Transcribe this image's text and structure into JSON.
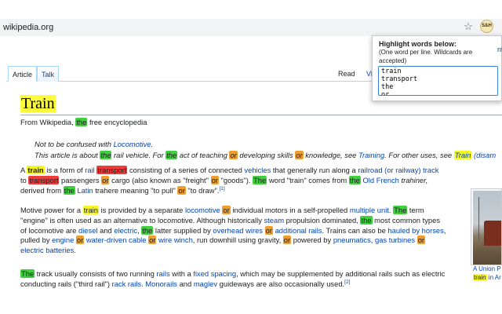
{
  "browser": {
    "url": "wikipedia.org",
    "star_icon": "star-icon",
    "extension_badge": "S&H"
  },
  "tabs": {
    "article": "Article",
    "talk": "Talk",
    "read": "Read",
    "view": "Vi"
  },
  "popup": {
    "title": "Highlight words below:",
    "hint_1": "(One word per line. Wildcards are",
    "hint_2": "accepted)",
    "words": [
      "train",
      "transport",
      "the",
      "or"
    ],
    "right_fragment": "nt"
  },
  "colors": {
    "train": "#f7f71e",
    "transport": "#ee3b3b",
    "the": "#3fcf3f",
    "or": "#f19d2c",
    "link": "#0645ad"
  },
  "article": {
    "title": "Train",
    "from": {
      "pre": "From Wikipedia, ",
      "the": "the",
      "post": " free encyclopedia"
    },
    "hatnote1": {
      "a": "Not to be confused with ",
      "link": "Locomotive",
      "b": "."
    },
    "hatnote2": {
      "a": "This article is about ",
      "the": "the",
      "b": " rail vehicle. For ",
      "the2": "the",
      "c": " act of teaching ",
      "or1": "or",
      "d": " developing skills ",
      "or2": "or",
      "e": " knowledge, see ",
      "link1": "Training",
      "f": ". For other uses, see ",
      "link2": "Train",
      "g": " (disam"
    },
    "p1": {
      "l1": {
        "a": "A ",
        "train": "train",
        "b": " is a form of ",
        "rail": "rail",
        "c": " ",
        "transport": "transport",
        "d": " consisting of a series of connected ",
        "vehicles": "vehicles",
        "e": " that generally run along a ",
        "railroad": "railroad (or railway) track"
      },
      "l2": {
        "a": "to ",
        "transport": "transport",
        "b": " passengers ",
        "or1": "or",
        "c": " cargo (also known as \"freight\" ",
        "or2": "or",
        "d": " \"goods\"). ",
        "the": "The",
        "e": " word \"train\" comes from ",
        "the2": "the",
        "f": " ",
        "oldfrench": "Old French",
        "g": " trahiner,"
      },
      "l3": {
        "a": "derived from ",
        "the": "the",
        "b": " ",
        "latin": "Latin",
        "c": " trahere meaning \"to pull\" ",
        "or": "or",
        "d": " \"to draw\".",
        "sup": "[1]"
      }
    },
    "p2": {
      "l1": {
        "a": "Motive power for a ",
        "train": "train",
        "b": " is provided by a separate ",
        "loco": "locomotive",
        "c": " ",
        "or": "or",
        "d": " individual motors in a self-propelled ",
        "mu": "multiple unit",
        "e": ". ",
        "the": "The",
        "f": " term"
      },
      "l2": {
        "a": "\"engine\" is often used as an alternative to locomotive. Although historically ",
        "steam": "steam",
        "b": " propulsion dominated, ",
        "the": "the",
        "c": " most common types"
      },
      "l3": {
        "a": "of locomotive are ",
        "diesel": "diesel",
        "b": " and ",
        "electric": "electric",
        "c": ", ",
        "the": "the",
        "d": " latter supplied by ",
        "ohw": "overhead wires",
        "e": " ",
        "or": "or",
        "f": " ",
        "add": "additional rails",
        "g": ". Trains can also be ",
        "horses": "hauled by horses",
        "h": ","
      },
      "l4": {
        "a": "pulled by ",
        "engine": "engine",
        "b": " ",
        "or1": "or",
        "c": " ",
        "wdc": "water-driven cable",
        "d": " ",
        "or2": "or",
        "e": " ",
        "winch": "wire winch",
        "f": ", run downhill using gravity, ",
        "or3": "or",
        "g": " powered by ",
        "pneu": "pneumatics",
        "h": ", ",
        "gas": "gas turbines",
        "i": " ",
        "or4": "or"
      },
      "l5": {
        "batt": "electric batteries",
        "a": "."
      }
    },
    "p3": {
      "l1": {
        "the": "The",
        "a": " track usually consists of two running ",
        "rails": "rails",
        "b": " with a ",
        "fixed": "fixed spacing",
        "c": ", which may be supplemented by additional rails such as electric"
      },
      "l2": {
        "a": "conducting rails (\"third rail\") ",
        "and": "and",
        "b": " ",
        "rack": "rack rails",
        "c": ". ",
        "mono": "Monorails",
        "d": " and ",
        "maglev": "maglev",
        "e": " guideways are also occasionally used.",
        "sup": "[2]"
      }
    },
    "caption": {
      "l1": "A Union P",
      "train": "train",
      "l2b": " in Ar"
    }
  }
}
